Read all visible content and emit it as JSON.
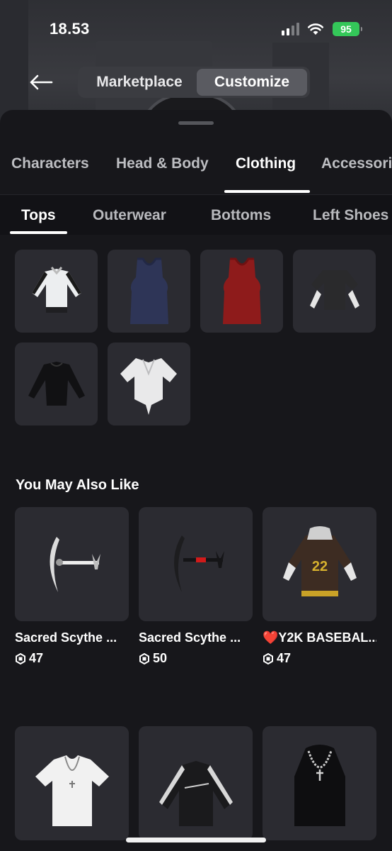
{
  "status": {
    "time": "18.53",
    "battery": "95"
  },
  "nav": {
    "marketplace_label": "Marketplace",
    "customize_label": "Customize"
  },
  "categories": [
    "Characters",
    "Head & Body",
    "Clothing",
    "Accessories"
  ],
  "subcategories": [
    "Tops",
    "Outerwear",
    "Bottoms",
    "Left Shoes"
  ],
  "section_title": "You May Also Like",
  "recommendations": [
    {
      "name": "Sacred Scythe ...",
      "price": "47"
    },
    {
      "name": "Sacred Scythe ...",
      "price": "50"
    },
    {
      "name": "❤️Y2K BASEBAL...",
      "price": "47"
    }
  ],
  "owned_tops": [
    {
      "icon": "white-track-jacket-icon"
    },
    {
      "icon": "navy-tank-top-icon"
    },
    {
      "icon": "red-tank-top-icon"
    },
    {
      "icon": "black-layered-shirt-icon"
    },
    {
      "icon": "black-long-sleeve-icon"
    },
    {
      "icon": "white-tied-shirt-icon"
    }
  ],
  "colors": {
    "accent_active": "#ffffff",
    "battery": "#34c759",
    "tile": "#2b2b31",
    "sheet": "#17171b"
  }
}
